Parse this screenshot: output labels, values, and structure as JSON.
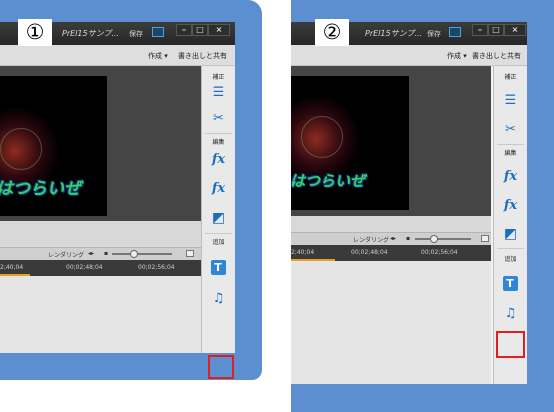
{
  "labels": {
    "one": "①",
    "two": "②"
  },
  "window": {
    "title": "PrEl15サンプ...",
    "save": "保存",
    "minimize": "–",
    "restore": "□",
    "close": "×"
  },
  "toolbar": {
    "create": "作成 ▾",
    "export": "書き出しと共有"
  },
  "video_caption": "はつらいぜ",
  "timeline": {
    "rendering": "レンダリング",
    "timecodes_1": [
      "00;02;48;04",
      "00;02;56;04"
    ],
    "timecodes_2": [
      "00;02;48;04",
      "00;02;56;04"
    ],
    "timecode_partial": "2;40;04"
  },
  "rightbar": {
    "correct": "補正",
    "edit": "編集",
    "add": "追加",
    "icons": [
      "adjust-icon",
      "tools-icon",
      "fx-pen-icon",
      "fx-icon",
      "transition-icon",
      "title-icon",
      "music-icon"
    ]
  },
  "colors": {
    "frame": "#5b8fd0",
    "highlight": "#e02020",
    "accent_icon": "#1c6fbf"
  }
}
